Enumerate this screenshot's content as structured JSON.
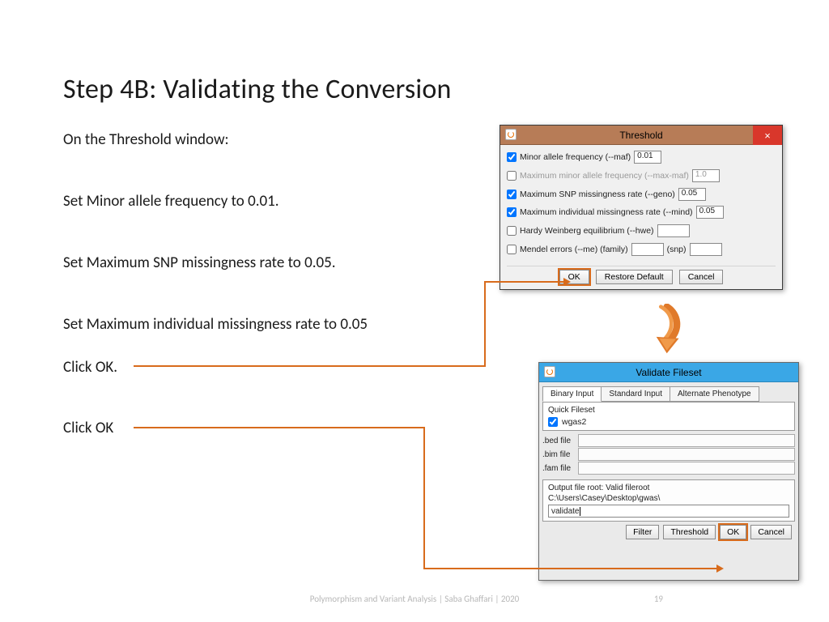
{
  "slide": {
    "title": "Step 4B: Validating the Conversion",
    "footer": "Polymorphism and Variant Analysis | Saba Ghaffari | 2020",
    "page": "19"
  },
  "instructions": {
    "intro_pre": "On the ",
    "intro_bold": "Threshold",
    "intro_post": " window:",
    "l1_pre": "Set ",
    "l1_bold": "Minor allele frequency",
    "l1_post": " to 0.01.",
    "l2_pre": "Set ",
    "l2_bold": "Maximum SNP missingness rate",
    "l2_post": " to 0.05.",
    "l3_pre": "Set ",
    "l3_bold": "Maximum individual missingness rate",
    "l3_post": " to 0.05",
    "l4_pre": "Click ",
    "l4_bold": "OK",
    "l4_post": ".",
    "l5_pre": "Click ",
    "l5_bold": "OK"
  },
  "threshold": {
    "title": "Threshold",
    "maf_label": "Minor allele frequency (--maf)",
    "maf_value": "0.01",
    "maxmaf_label": "Maximum minor allele frequency (--max-maf)",
    "maxmaf_value": "1.0",
    "geno_label": "Maximum SNP missingness rate (--geno)",
    "geno_value": "0.05",
    "mind_label": "Maximum individual missingness rate (--mind)",
    "mind_value": "0.05",
    "hwe_label": "Hardy Weinberg equilibrium (--hwe)",
    "me_label": "Mendel errors (--me)   (family)",
    "me_snp": "(snp)",
    "ok": "OK",
    "restore": "Restore Default",
    "cancel": "Cancel"
  },
  "validate": {
    "title": "Validate Fileset",
    "tab1": "Binary Input",
    "tab2": "Standard Input",
    "tab3": "Alternate Phenotype",
    "quick_fileset": "Quick Fileset",
    "wgas2": "wgas2",
    "bed": ".bed file",
    "bim": ".bim file",
    "fam": ".fam file",
    "output_label": "Output file root: Valid fileroot",
    "output_path": "C:\\Users\\Casey\\Desktop\\gwas\\",
    "output_value": "validate",
    "filter": "Filter",
    "threshold": "Threshold",
    "ok": "OK",
    "cancel": "Cancel"
  }
}
